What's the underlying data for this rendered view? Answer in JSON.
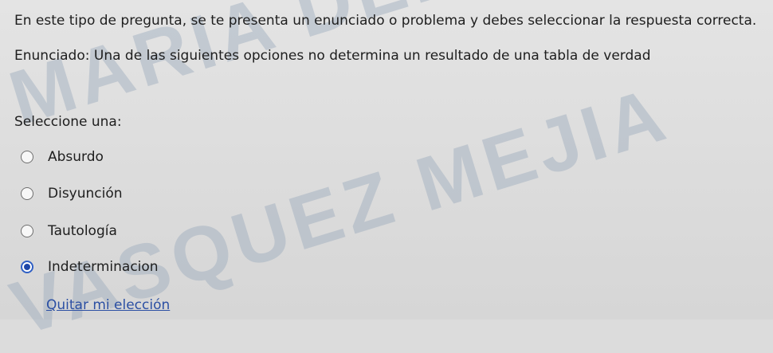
{
  "question": {
    "instruction": "En este tipo de pregunta, se te presenta un enunciado o problema y debes seleccionar la respuesta correcta.",
    "statement": "Enunciado: Una de las siguientes opciones no determina un resultado de una tabla de verdad",
    "prompt": "Seleccione una:"
  },
  "options": [
    {
      "label": "Absurdo",
      "selected": false
    },
    {
      "label": "Disyunción",
      "selected": false
    },
    {
      "label": "Tautología",
      "selected": false
    },
    {
      "label": "Indeterminacion",
      "selected": true
    }
  ],
  "clear_choice": "Quitar mi elección",
  "watermark": {
    "line1": "MARIA DEL CARMEN",
    "line2": "VASQUEZ MEJIA"
  },
  "colors": {
    "background": "#dcdcdc",
    "link": "#2b4fa3",
    "radio_selected": "#1f47a8",
    "watermark": "#96a8ba"
  }
}
